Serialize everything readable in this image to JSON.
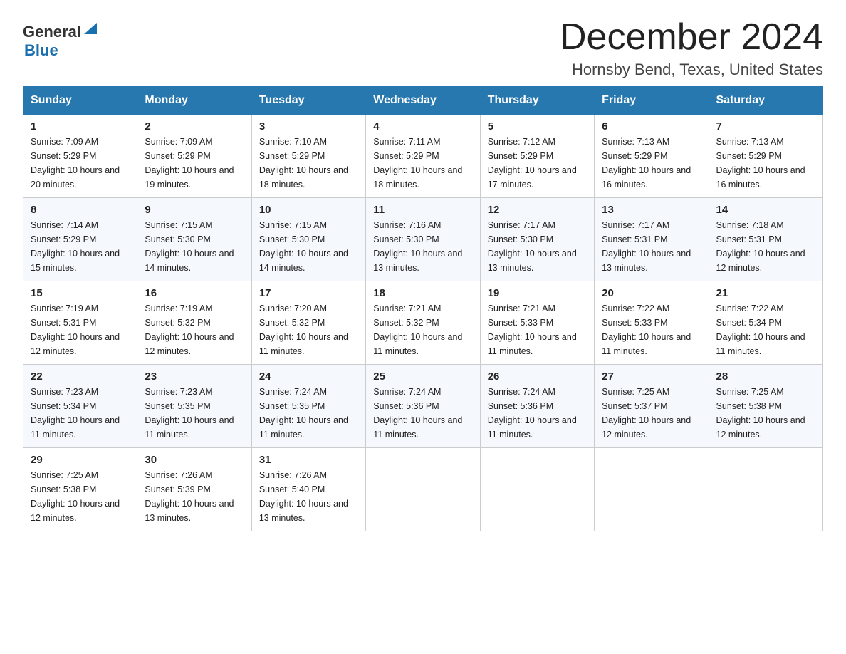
{
  "logo": {
    "text_general": "General",
    "text_blue": "Blue"
  },
  "header": {
    "month_title": "December 2024",
    "location": "Hornsby Bend, Texas, United States"
  },
  "days_of_week": [
    "Sunday",
    "Monday",
    "Tuesday",
    "Wednesday",
    "Thursday",
    "Friday",
    "Saturday"
  ],
  "weeks": [
    [
      {
        "day": "1",
        "sunrise": "7:09 AM",
        "sunset": "5:29 PM",
        "daylight": "10 hours and 20 minutes."
      },
      {
        "day": "2",
        "sunrise": "7:09 AM",
        "sunset": "5:29 PM",
        "daylight": "10 hours and 19 minutes."
      },
      {
        "day": "3",
        "sunrise": "7:10 AM",
        "sunset": "5:29 PM",
        "daylight": "10 hours and 18 minutes."
      },
      {
        "day": "4",
        "sunrise": "7:11 AM",
        "sunset": "5:29 PM",
        "daylight": "10 hours and 18 minutes."
      },
      {
        "day": "5",
        "sunrise": "7:12 AM",
        "sunset": "5:29 PM",
        "daylight": "10 hours and 17 minutes."
      },
      {
        "day": "6",
        "sunrise": "7:13 AM",
        "sunset": "5:29 PM",
        "daylight": "10 hours and 16 minutes."
      },
      {
        "day": "7",
        "sunrise": "7:13 AM",
        "sunset": "5:29 PM",
        "daylight": "10 hours and 16 minutes."
      }
    ],
    [
      {
        "day": "8",
        "sunrise": "7:14 AM",
        "sunset": "5:29 PM",
        "daylight": "10 hours and 15 minutes."
      },
      {
        "day": "9",
        "sunrise": "7:15 AM",
        "sunset": "5:30 PM",
        "daylight": "10 hours and 14 minutes."
      },
      {
        "day": "10",
        "sunrise": "7:15 AM",
        "sunset": "5:30 PM",
        "daylight": "10 hours and 14 minutes."
      },
      {
        "day": "11",
        "sunrise": "7:16 AM",
        "sunset": "5:30 PM",
        "daylight": "10 hours and 13 minutes."
      },
      {
        "day": "12",
        "sunrise": "7:17 AM",
        "sunset": "5:30 PM",
        "daylight": "10 hours and 13 minutes."
      },
      {
        "day": "13",
        "sunrise": "7:17 AM",
        "sunset": "5:31 PM",
        "daylight": "10 hours and 13 minutes."
      },
      {
        "day": "14",
        "sunrise": "7:18 AM",
        "sunset": "5:31 PM",
        "daylight": "10 hours and 12 minutes."
      }
    ],
    [
      {
        "day": "15",
        "sunrise": "7:19 AM",
        "sunset": "5:31 PM",
        "daylight": "10 hours and 12 minutes."
      },
      {
        "day": "16",
        "sunrise": "7:19 AM",
        "sunset": "5:32 PM",
        "daylight": "10 hours and 12 minutes."
      },
      {
        "day": "17",
        "sunrise": "7:20 AM",
        "sunset": "5:32 PM",
        "daylight": "10 hours and 11 minutes."
      },
      {
        "day": "18",
        "sunrise": "7:21 AM",
        "sunset": "5:32 PM",
        "daylight": "10 hours and 11 minutes."
      },
      {
        "day": "19",
        "sunrise": "7:21 AM",
        "sunset": "5:33 PM",
        "daylight": "10 hours and 11 minutes."
      },
      {
        "day": "20",
        "sunrise": "7:22 AM",
        "sunset": "5:33 PM",
        "daylight": "10 hours and 11 minutes."
      },
      {
        "day": "21",
        "sunrise": "7:22 AM",
        "sunset": "5:34 PM",
        "daylight": "10 hours and 11 minutes."
      }
    ],
    [
      {
        "day": "22",
        "sunrise": "7:23 AM",
        "sunset": "5:34 PM",
        "daylight": "10 hours and 11 minutes."
      },
      {
        "day": "23",
        "sunrise": "7:23 AM",
        "sunset": "5:35 PM",
        "daylight": "10 hours and 11 minutes."
      },
      {
        "day": "24",
        "sunrise": "7:24 AM",
        "sunset": "5:35 PM",
        "daylight": "10 hours and 11 minutes."
      },
      {
        "day": "25",
        "sunrise": "7:24 AM",
        "sunset": "5:36 PM",
        "daylight": "10 hours and 11 minutes."
      },
      {
        "day": "26",
        "sunrise": "7:24 AM",
        "sunset": "5:36 PM",
        "daylight": "10 hours and 11 minutes."
      },
      {
        "day": "27",
        "sunrise": "7:25 AM",
        "sunset": "5:37 PM",
        "daylight": "10 hours and 12 minutes."
      },
      {
        "day": "28",
        "sunrise": "7:25 AM",
        "sunset": "5:38 PM",
        "daylight": "10 hours and 12 minutes."
      }
    ],
    [
      {
        "day": "29",
        "sunrise": "7:25 AM",
        "sunset": "5:38 PM",
        "daylight": "10 hours and 12 minutes."
      },
      {
        "day": "30",
        "sunrise": "7:26 AM",
        "sunset": "5:39 PM",
        "daylight": "10 hours and 13 minutes."
      },
      {
        "day": "31",
        "sunrise": "7:26 AM",
        "sunset": "5:40 PM",
        "daylight": "10 hours and 13 minutes."
      },
      {
        "day": "",
        "sunrise": "",
        "sunset": "",
        "daylight": ""
      },
      {
        "day": "",
        "sunrise": "",
        "sunset": "",
        "daylight": ""
      },
      {
        "day": "",
        "sunrise": "",
        "sunset": "",
        "daylight": ""
      },
      {
        "day": "",
        "sunrise": "",
        "sunset": "",
        "daylight": ""
      }
    ]
  ]
}
